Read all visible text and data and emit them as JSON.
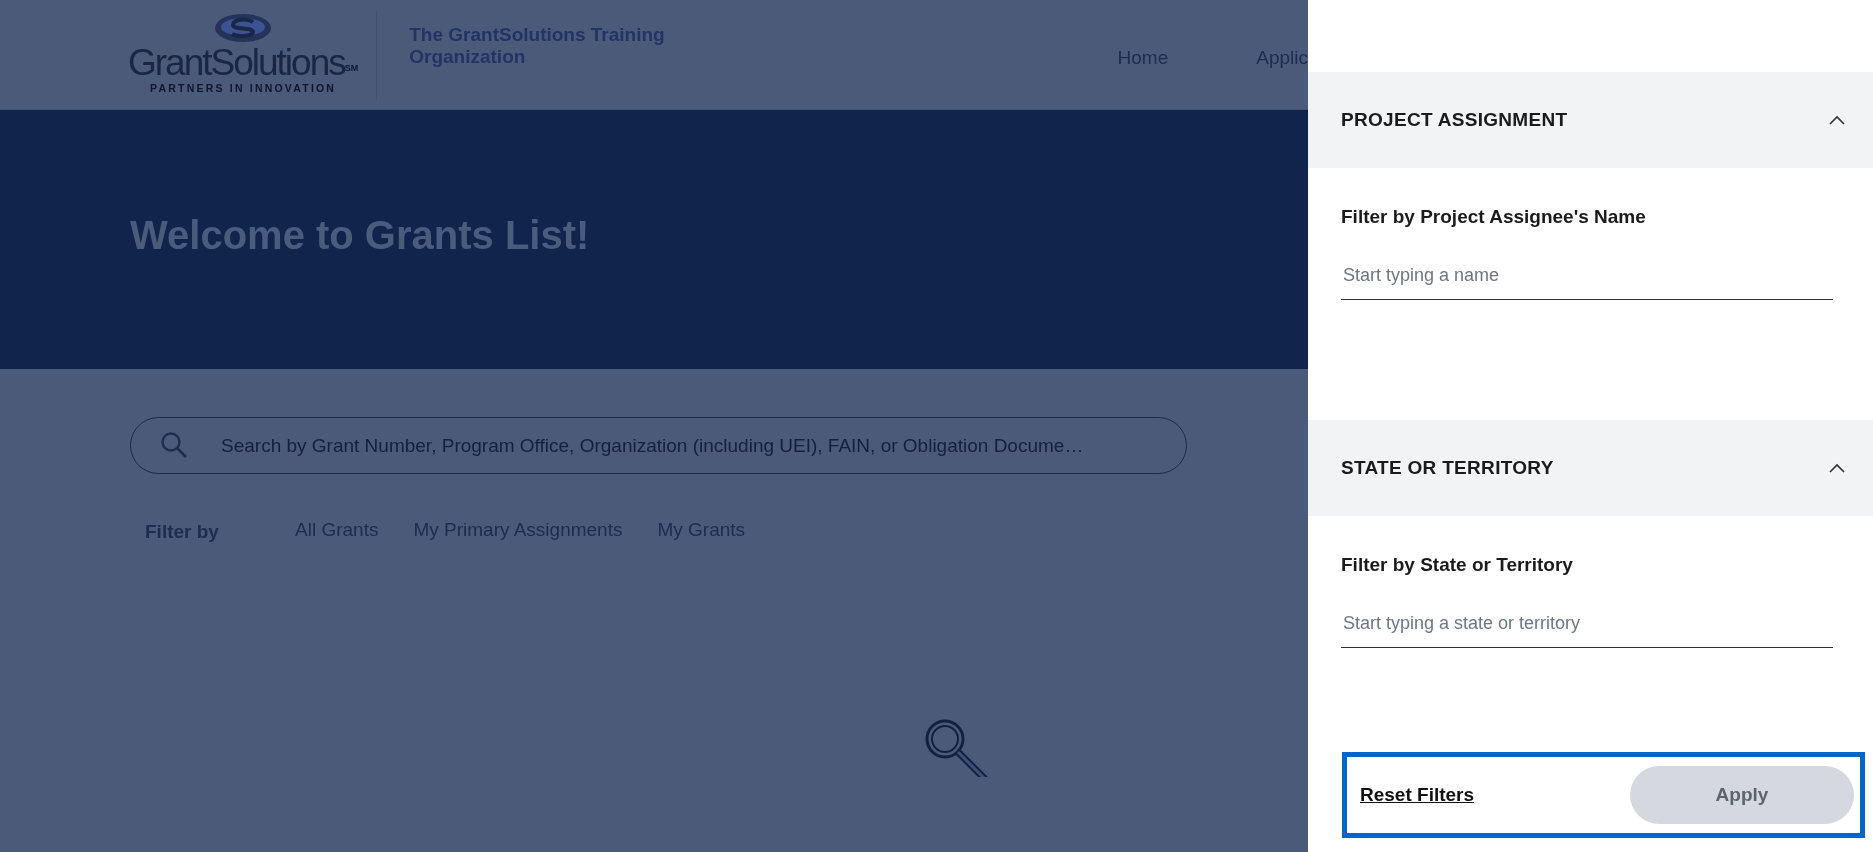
{
  "header": {
    "logo": {
      "name": "GrantSolutions",
      "mark": "SM",
      "tagline": "PARTNERS IN INNOVATION"
    },
    "organization": "The GrantSolutions Training Organization",
    "nav": [
      {
        "label": "Home"
      },
      {
        "label": "Applic"
      }
    ]
  },
  "hero": {
    "title": "Welcome to Grants List!"
  },
  "search": {
    "placeholder": "Search by Grant Number, Program Office, Organization (including UEI), FAIN, or Obligation Docume…"
  },
  "filter_bar": {
    "label": "Filter by",
    "tabs": [
      {
        "label": "All Grants",
        "selected": false
      },
      {
        "label": "My Primary Assignments",
        "selected": false
      },
      {
        "label": "My Grants",
        "selected": false
      }
    ]
  },
  "drawer": {
    "sections": [
      {
        "title": "PROJECT ASSIGNMENT",
        "expanded": true,
        "field_label": "Filter by Project Assignee's Name",
        "placeholder": "Start typing a name"
      },
      {
        "title": "STATE OR TERRITORY",
        "expanded": true,
        "field_label": "Filter by State or Territory",
        "placeholder": "Start typing a state or territory"
      }
    ],
    "reset": "Reset Filters",
    "apply": {
      "label": "Apply",
      "disabled": true
    }
  }
}
